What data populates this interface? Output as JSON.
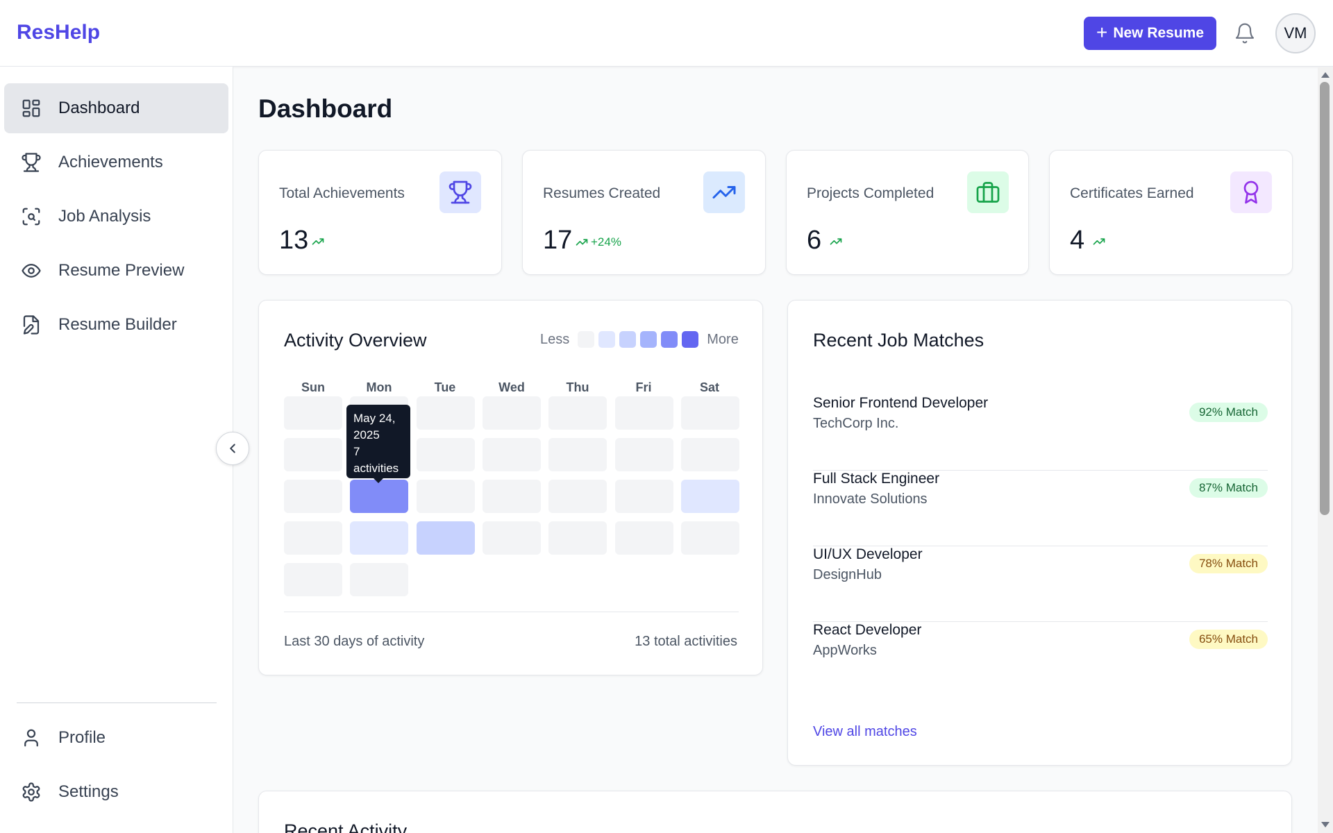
{
  "app": {
    "brand": "ResHelp"
  },
  "header": {
    "new_resume_label": "New Resume",
    "avatar_initials": "VM"
  },
  "sidebar": {
    "items": [
      {
        "label": "Dashboard",
        "icon": "dashboard-grid-icon",
        "active": true
      },
      {
        "label": "Achievements",
        "icon": "trophy-icon"
      },
      {
        "label": "Job Analysis",
        "icon": "scan-search-icon"
      },
      {
        "label": "Resume Preview",
        "icon": "eye-icon"
      },
      {
        "label": "Resume Builder",
        "icon": "file-edit-icon"
      }
    ],
    "bottom_items": [
      {
        "label": "Profile",
        "icon": "user-icon"
      },
      {
        "label": "Settings",
        "icon": "gear-icon"
      }
    ]
  },
  "main": {
    "title": "Dashboard",
    "stats": [
      {
        "label": "Total Achievements",
        "value": "13",
        "trend": "",
        "icon": "trophy-icon",
        "color": "#4f46e5"
      },
      {
        "label": "Resumes Created",
        "value": "17",
        "trend": "+24%",
        "icon": "trending-up-icon",
        "color": "#2563eb"
      },
      {
        "label": "Projects Completed",
        "value": "6",
        "trend": "",
        "icon": "briefcase-icon",
        "color": "#16a34a"
      },
      {
        "label": "Certificates Earned",
        "value": "4",
        "trend": "",
        "icon": "award-icon",
        "color": "#9333ea"
      }
    ],
    "activity": {
      "title": "Activity Overview",
      "legend_less": "Less",
      "legend_more": "More",
      "legend_colors": [
        "#f3f4f6",
        "#e0e7ff",
        "#c7d2fe",
        "#a5b4fc",
        "#818cf8",
        "#6366f1"
      ],
      "days": [
        "Sun",
        "Mon",
        "Tue",
        "Wed",
        "Thu",
        "Fri",
        "Sat"
      ],
      "grid_levels": [
        [
          0,
          0,
          0,
          0,
          0,
          0,
          0
        ],
        [
          0,
          0,
          0,
          0,
          0,
          0,
          0
        ],
        [
          0,
          4,
          0,
          0,
          0,
          0,
          1
        ],
        [
          0,
          1,
          2,
          0,
          0,
          0,
          0
        ],
        [
          0,
          0
        ]
      ],
      "tooltip": {
        "date_line1": "May 24,",
        "date_line2": "2025",
        "count_line1": "7",
        "count_line2": "activities"
      },
      "footer_left": "Last 30 days of activity",
      "footer_right": "13 total activities"
    },
    "job_matches": {
      "title": "Recent Job Matches",
      "items": [
        {
          "title": "Senior Frontend Developer",
          "company": "TechCorp Inc.",
          "match": "92% Match",
          "level": "green"
        },
        {
          "title": "Full Stack Engineer",
          "company": "Innovate Solutions",
          "match": "87% Match",
          "level": "green"
        },
        {
          "title": "UI/UX Developer",
          "company": "DesignHub",
          "match": "78% Match",
          "level": "yellow"
        },
        {
          "title": "React Developer",
          "company": "AppWorks",
          "match": "65% Match",
          "level": "yellow"
        }
      ],
      "view_all": "View all matches"
    },
    "recent_activity": {
      "title": "Recent Activity"
    }
  },
  "colors": {
    "accent": "#4f46e5",
    "success": "#16a34a"
  }
}
